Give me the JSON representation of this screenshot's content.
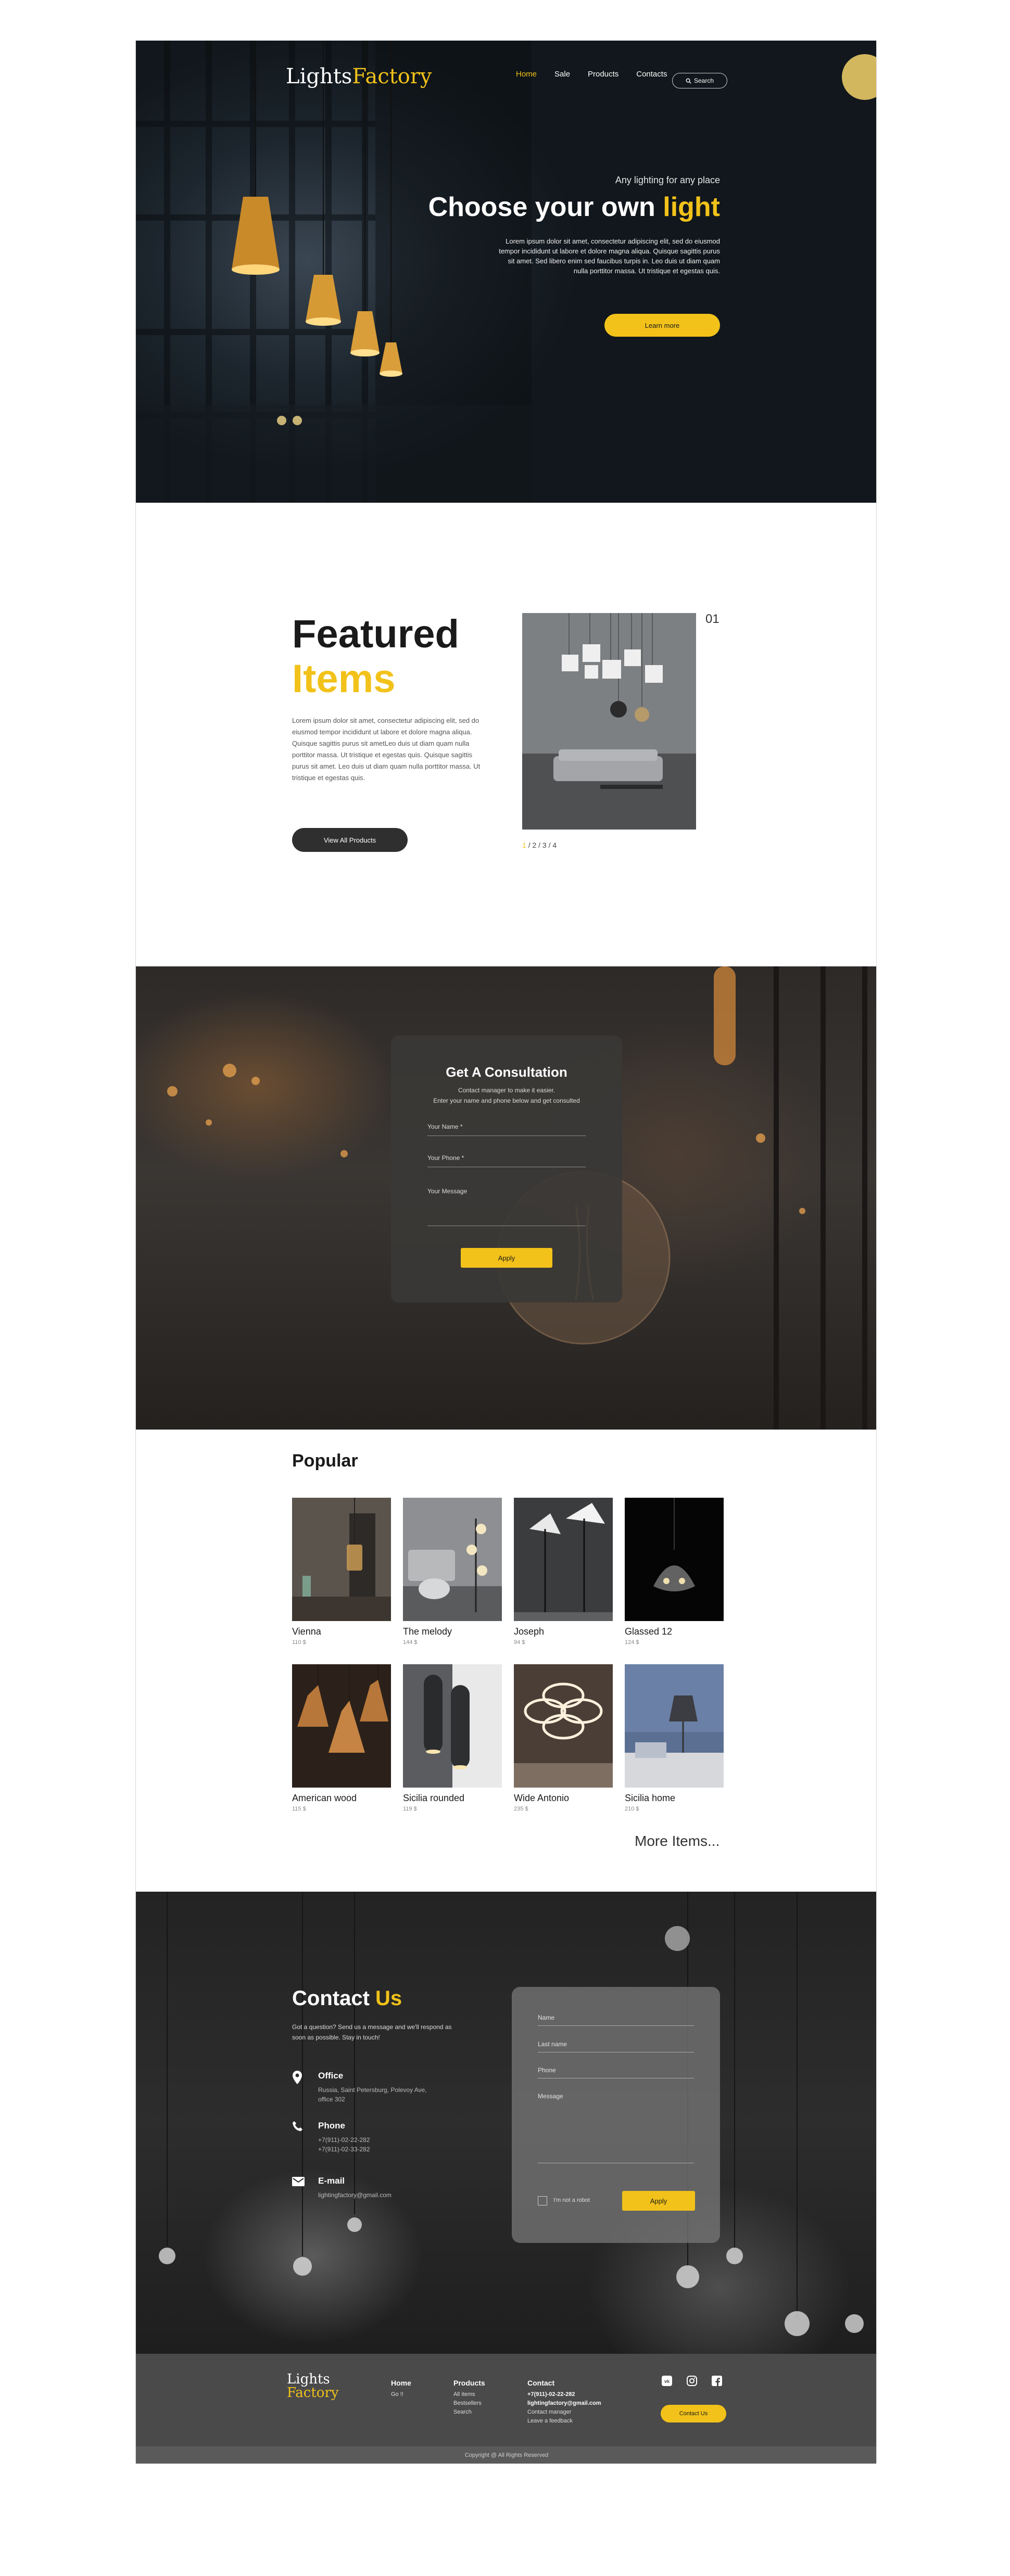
{
  "brand": {
    "logo_part1": "Lights",
    "logo_part2": "Factory",
    "accent_color": "#f2c21a",
    "dark_color": "#2f2f2f"
  },
  "nav": {
    "items": [
      "Home",
      "Sale",
      "Products",
      "Contacts"
    ],
    "active": "Home",
    "search_label": "Search",
    "search_icon": "search-icon"
  },
  "hero": {
    "eyebrow": "Any lighting for any place",
    "title_main": "Choose your own ",
    "title_accent": "light",
    "paragraph": "Lorem ipsum dolor sit amet, consectetur adipiscing elit, sed do eiusmod tempor incididunt ut labore et dolore magna aliqua. Quisque sagittis purus sit amet. Sed libero enim sed faucibus turpis in. Leo duis ut diam quam nulla porttitor massa. Ut tristique et egestas quis.",
    "cta": "Learn more"
  },
  "featured": {
    "title_line1": "Featured",
    "title_line2": "Items",
    "paragraph": "Lorem ipsum dolor sit amet, consectetur adipiscing elit, sed do eiusmod tempor incididunt ut labore et dolore magna aliqua. Quisque sagittis purus sit ametLeo duis ut diam quam nulla porttitor massa. Ut tristique et egestas quis. Quisque sagittis purus sit amet. Leo duis ut diam quam nulla porttitor massa. Ut tristique et egestas quis.",
    "button": "View All Products",
    "number": "01",
    "pager": {
      "current": "1",
      "rest": "/ 2 / 3 / 4"
    }
  },
  "consultation": {
    "title": "Get A Consultation",
    "subtitle_line1": "Contact manager to make it easier.",
    "subtitle_line2": "Enter your name and phone below and get consulted",
    "name_label": "Your Name *",
    "phone_label": "Your Phone *",
    "message_label": "Your Message",
    "button": "Apply"
  },
  "popular": {
    "title": "Popular",
    "items": [
      {
        "name": "Vienna",
        "price": "110 $"
      },
      {
        "name": "The melody",
        "price": "144 $"
      },
      {
        "name": "Joseph",
        "price": "94 $"
      },
      {
        "name": "Glassed 12",
        "price": "124 $"
      },
      {
        "name": "American wood",
        "price": "115 $"
      },
      {
        "name": "Sicilia rounded",
        "price": "119 $"
      },
      {
        "name": "Wide Antonio",
        "price": "235 $"
      },
      {
        "name": "Sicilia home",
        "price": "210 $"
      }
    ],
    "more": "More Items..."
  },
  "contact": {
    "title_main": "Contact ",
    "title_accent": "Us",
    "paragraph": "Got a question? Send us a message and we'll respond as soon as possible. Stay in touch!",
    "office_title": "Office",
    "office_text": "Russia, Saint Petersburg, Polevoy Ave, office 302",
    "phone_title": "Phone",
    "phone_1": "+7(911)-02-22-282",
    "phone_2": "+7(911)-02-33-282",
    "email_title": "E-mail",
    "email_text": "lightingfactory@gmail.com",
    "form": {
      "name": "Name",
      "last_name": "Last name",
      "phone": "Phone",
      "message": "Message",
      "robot": "I'm not a robot",
      "button": "Apply"
    }
  },
  "footer": {
    "logo_line1": "Lights",
    "logo_line2": "Factory",
    "home_title": "Home",
    "home_items": [
      "Go !!"
    ],
    "products_title": "Products",
    "products_items": [
      "All items",
      "Bestsellers",
      "Search"
    ],
    "contact_title": "Contact",
    "contact_items": [
      "+7(911)-02-22-282",
      "lightingfactory@gmail.com",
      "Contact manager",
      "Leave a feedback"
    ],
    "contact_button": "Contact Us",
    "social": [
      "vk-icon",
      "instagram-icon",
      "facebook-icon"
    ],
    "copyright": "Copyright @ All Rights Reserved"
  }
}
